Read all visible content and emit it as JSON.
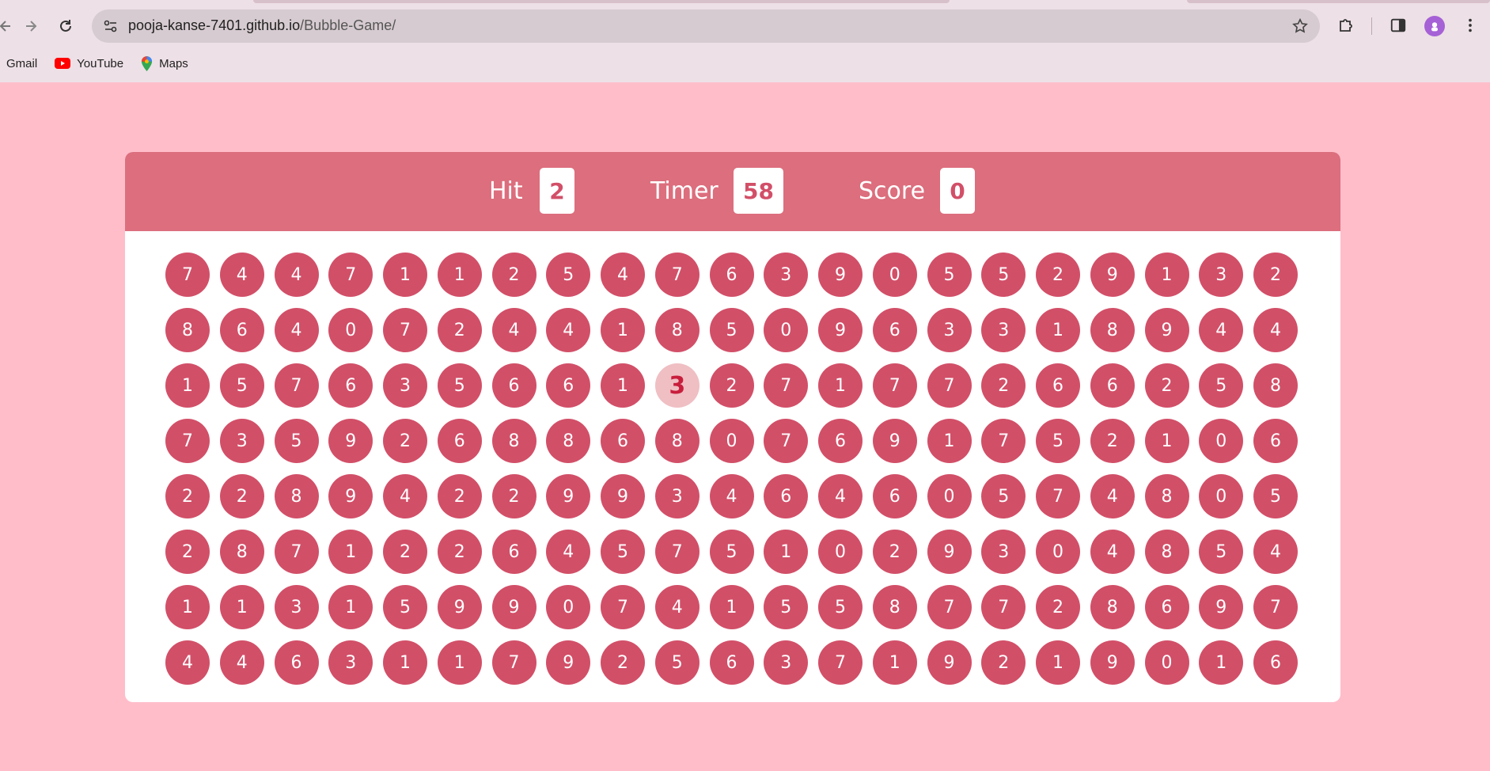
{
  "browser": {
    "url_host": "pooja-kanse-7401.github.io",
    "url_path": "/Bubble-Game/",
    "bookmarks": [
      {
        "label": "Gmail",
        "icon": "gmail-icon"
      },
      {
        "label": "YouTube",
        "icon": "youtube-icon"
      },
      {
        "label": "Maps",
        "icon": "maps-icon"
      }
    ]
  },
  "game": {
    "hit_label": "Hit",
    "hit_value": "2",
    "timer_label": "Timer",
    "timer_value": "58",
    "score_label": "Score",
    "score_value": "0",
    "highlighted_bubble": {
      "row": 2,
      "col": 9
    },
    "rows": [
      [
        7,
        4,
        4,
        7,
        1,
        1,
        2,
        5,
        4,
        7,
        6,
        3,
        9,
        0,
        5,
        5,
        2,
        9,
        1,
        3,
        2
      ],
      [
        8,
        6,
        4,
        0,
        7,
        2,
        4,
        4,
        1,
        8,
        5,
        0,
        9,
        6,
        3,
        3,
        1,
        8,
        9,
        4,
        4
      ],
      [
        1,
        5,
        7,
        6,
        3,
        5,
        6,
        6,
        1,
        3,
        2,
        7,
        1,
        7,
        7,
        2,
        6,
        6,
        2,
        5,
        8
      ],
      [
        7,
        3,
        5,
        9,
        2,
        6,
        8,
        8,
        6,
        8,
        0,
        7,
        6,
        9,
        1,
        7,
        5,
        2,
        1,
        0,
        6
      ],
      [
        2,
        2,
        8,
        9,
        4,
        2,
        2,
        9,
        9,
        3,
        4,
        6,
        4,
        6,
        0,
        5,
        7,
        4,
        8,
        0,
        5
      ],
      [
        2,
        8,
        7,
        1,
        2,
        2,
        6,
        4,
        5,
        7,
        5,
        1,
        0,
        2,
        9,
        3,
        0,
        4,
        8,
        5,
        4
      ],
      [
        1,
        1,
        3,
        1,
        5,
        9,
        9,
        0,
        7,
        4,
        1,
        5,
        5,
        8,
        7,
        7,
        2,
        8,
        6,
        9,
        7
      ],
      [
        4,
        4,
        6,
        3,
        1,
        1,
        7,
        9,
        2,
        5,
        6,
        3,
        7,
        1,
        9,
        2,
        1,
        9,
        0,
        1,
        6
      ]
    ]
  },
  "colors": {
    "page_bg": "#ffbdca",
    "panel_top": "#dc6e7d",
    "bubble": "#d24f68",
    "bubble_hover": "#efbfc3"
  }
}
